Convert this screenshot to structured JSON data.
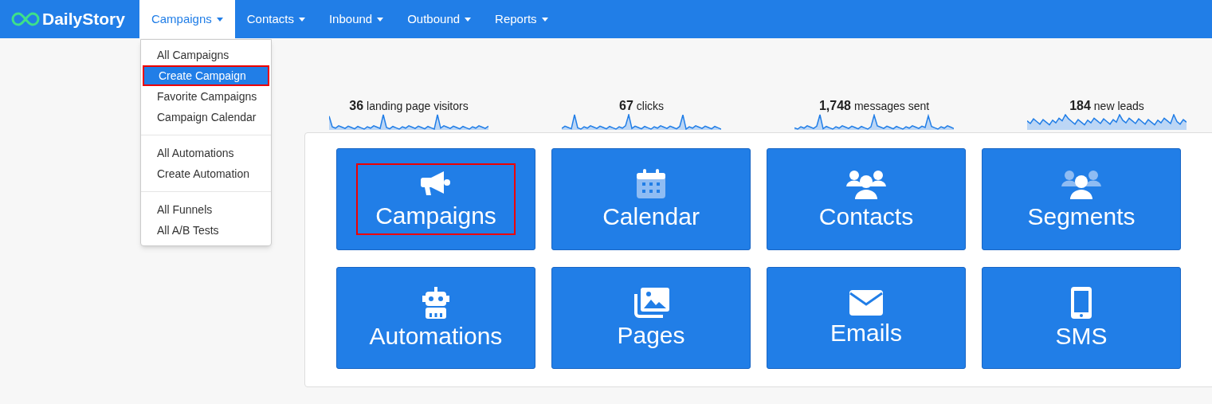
{
  "brand": "DailyStory",
  "nav": [
    {
      "label": "Campaigns",
      "selected": true
    },
    {
      "label": "Contacts",
      "selected": false
    },
    {
      "label": "Inbound",
      "selected": false
    },
    {
      "label": "Outbound",
      "selected": false
    },
    {
      "label": "Reports",
      "selected": false
    }
  ],
  "dropdown": {
    "groups": [
      {
        "items": [
          {
            "label": "All Campaigns",
            "selected": false,
            "highlighted": false
          },
          {
            "label": "Create Campaign",
            "selected": true,
            "highlighted": true
          },
          {
            "label": "Favorite Campaigns",
            "selected": false,
            "highlighted": false
          },
          {
            "label": "Campaign Calendar",
            "selected": false,
            "highlighted": false
          }
        ]
      },
      {
        "items": [
          {
            "label": "All Automations",
            "selected": false,
            "highlighted": false
          },
          {
            "label": "Create Automation",
            "selected": false,
            "highlighted": false
          }
        ]
      },
      {
        "items": [
          {
            "label": "All Funnels",
            "selected": false,
            "highlighted": false
          },
          {
            "label": "All A/B Tests",
            "selected": false,
            "highlighted": false
          }
        ]
      }
    ]
  },
  "stats": [
    {
      "value": "36",
      "label": "landing page visitors"
    },
    {
      "value": "67",
      "label": "clicks"
    },
    {
      "value": "1,748",
      "label": "messages sent"
    },
    {
      "value": "184",
      "label": "new leads"
    }
  ],
  "tiles": [
    {
      "label": "Campaigns",
      "highlighted": true
    },
    {
      "label": "Calendar",
      "highlighted": false
    },
    {
      "label": "Contacts",
      "highlighted": false
    },
    {
      "label": "Segments",
      "highlighted": false
    },
    {
      "label": "Automations",
      "highlighted": false
    },
    {
      "label": "Pages",
      "highlighted": false
    },
    {
      "label": "Emails",
      "highlighted": false
    },
    {
      "label": "SMS",
      "highlighted": false
    }
  ]
}
